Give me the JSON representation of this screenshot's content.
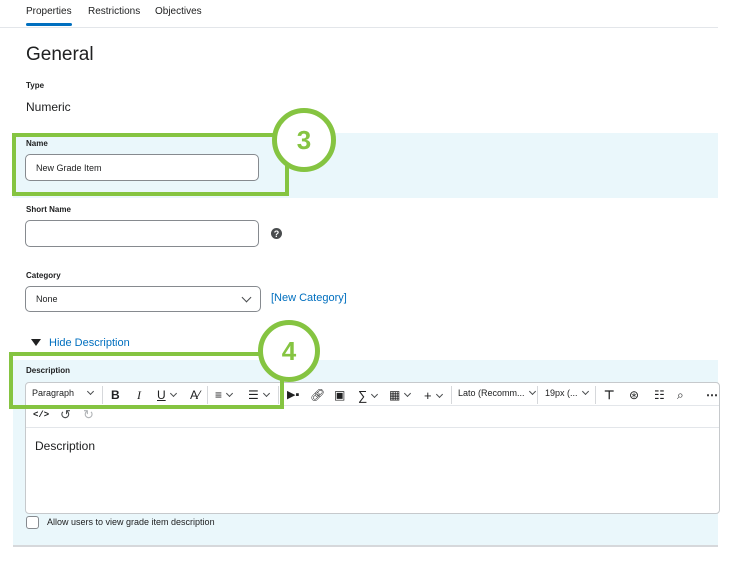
{
  "tabs": [
    {
      "label": "Properties",
      "active": true
    },
    {
      "label": "Restrictions",
      "active": false
    },
    {
      "label": "Objectives",
      "active": false
    }
  ],
  "page_title": "General",
  "type": {
    "label": "Type",
    "value": "Numeric"
  },
  "name": {
    "label": "Name",
    "value": "New Grade Item"
  },
  "short_name": {
    "label": "Short Name",
    "value": ""
  },
  "category": {
    "label": "Category",
    "selected": "None",
    "new_link": "[New Category]"
  },
  "description_toggle": "Hide Description",
  "description": {
    "label": "Description",
    "content": "Description",
    "toolbar": {
      "paragraph": "Paragraph",
      "bold": "B",
      "italic": "I",
      "underline": "U",
      "font": "Lato (Recomm...",
      "size": "19px (..."
    }
  },
  "allow_checkbox": {
    "label": "Allow users to view grade item description",
    "checked": false
  },
  "annotations": {
    "step3": "3",
    "step4": "4"
  },
  "colors": {
    "accent": "#006fbf",
    "highlight": "#eaf7fb",
    "annotation": "#85c441"
  }
}
